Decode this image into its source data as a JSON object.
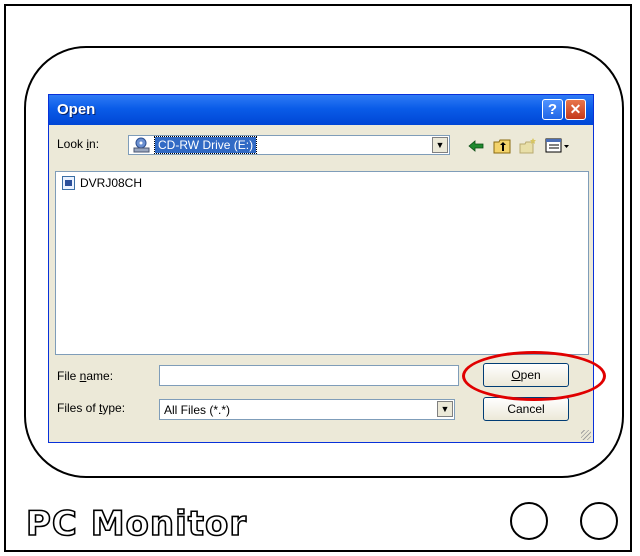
{
  "monitor": {
    "brand": "PC Monitor"
  },
  "dialog": {
    "title": "Open",
    "help_glyph": "?",
    "close_glyph": "✕",
    "lookin_label_pre": "Look ",
    "lookin_label_ul": "i",
    "lookin_label_post": "n:",
    "lookin_value": "CD-RW Drive (E:)",
    "files": [
      "DVRJ08CH"
    ],
    "filename_label_pre": "File ",
    "filename_label_ul": "n",
    "filename_label_post": "ame:",
    "filename_value": "",
    "filetype_label_pre": "Files of ",
    "filetype_label_ul": "t",
    "filetype_label_post": "ype:",
    "filetype_value": "All Files (*.*)",
    "open_ul": "O",
    "open_rest": "pen",
    "cancel_label": "Cancel"
  },
  "colors": {
    "titlebar": "#0a5ce8",
    "selection": "#316ac5",
    "highlight_circle": "#e00000"
  },
  "icons": [
    "drive-icon",
    "back-arrow-icon",
    "up-folder-icon",
    "new-folder-icon",
    "views-menu-icon",
    "file-icon"
  ]
}
